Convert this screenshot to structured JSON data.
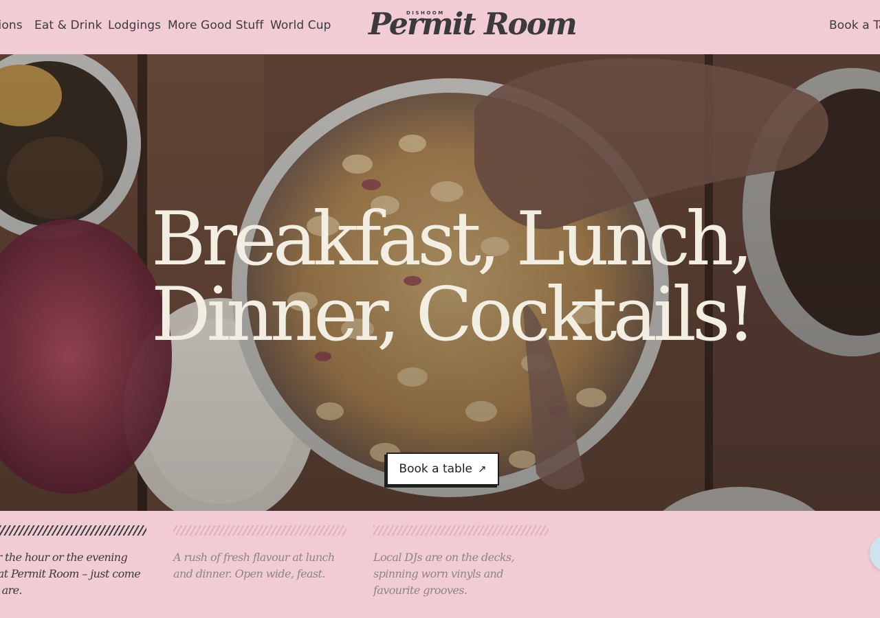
{
  "header": {
    "nav_left": [
      {
        "label": "Locations"
      },
      {
        "label": "Eat & Drink"
      },
      {
        "label": "Lodgings"
      },
      {
        "label": "More Good Stuff"
      },
      {
        "label": "World Cup"
      }
    ],
    "logo": {
      "small": "DISHOOM",
      "main": "Permit Room"
    },
    "nav_right": {
      "label": "Book a Table"
    }
  },
  "hero": {
    "headline_line1": "Breakfast, Lunch,",
    "headline_line2": "Dinner, Cocktails!",
    "cta_label": "Book a table",
    "cta_icon": "arrow-up-right-icon"
  },
  "features": [
    {
      "text": "Gather the hour or the evening mood at Permit Room – just come as you are."
    },
    {
      "text": "A rush of fresh flavour at lunch and dinner. Open wide, feast."
    },
    {
      "text": "Local DJs are on the decks, spinning worn vinyls and favourite grooves."
    }
  ],
  "colors": {
    "background": "#f1ccd5",
    "text": "#3b3a3c",
    "headline": "#f3eee2",
    "muted": "#8d8489"
  },
  "chat": {
    "icon": "chat-bubble-icon"
  }
}
